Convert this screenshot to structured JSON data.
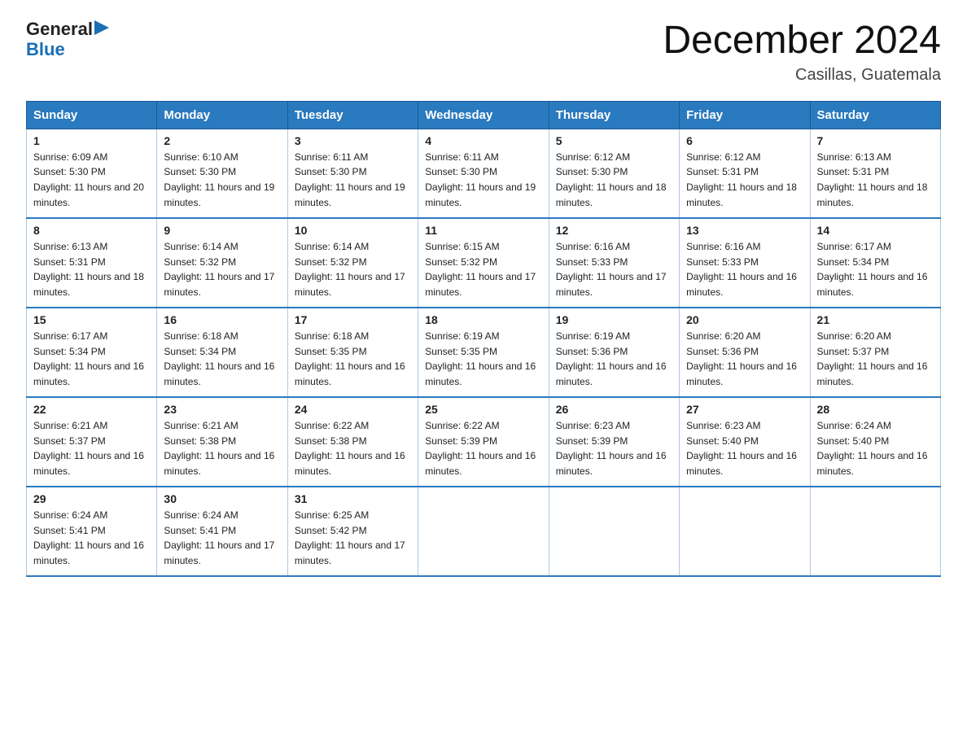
{
  "logo": {
    "general": "General",
    "triangle": "▶",
    "blue": "Blue"
  },
  "header": {
    "month": "December 2024",
    "location": "Casillas, Guatemala"
  },
  "weekdays": [
    "Sunday",
    "Monday",
    "Tuesday",
    "Wednesday",
    "Thursday",
    "Friday",
    "Saturday"
  ],
  "weeks": [
    [
      {
        "day": "1",
        "sunrise": "6:09 AM",
        "sunset": "5:30 PM",
        "daylight": "11 hours and 20 minutes."
      },
      {
        "day": "2",
        "sunrise": "6:10 AM",
        "sunset": "5:30 PM",
        "daylight": "11 hours and 19 minutes."
      },
      {
        "day": "3",
        "sunrise": "6:11 AM",
        "sunset": "5:30 PM",
        "daylight": "11 hours and 19 minutes."
      },
      {
        "day": "4",
        "sunrise": "6:11 AM",
        "sunset": "5:30 PM",
        "daylight": "11 hours and 19 minutes."
      },
      {
        "day": "5",
        "sunrise": "6:12 AM",
        "sunset": "5:30 PM",
        "daylight": "11 hours and 18 minutes."
      },
      {
        "day": "6",
        "sunrise": "6:12 AM",
        "sunset": "5:31 PM",
        "daylight": "11 hours and 18 minutes."
      },
      {
        "day": "7",
        "sunrise": "6:13 AM",
        "sunset": "5:31 PM",
        "daylight": "11 hours and 18 minutes."
      }
    ],
    [
      {
        "day": "8",
        "sunrise": "6:13 AM",
        "sunset": "5:31 PM",
        "daylight": "11 hours and 18 minutes."
      },
      {
        "day": "9",
        "sunrise": "6:14 AM",
        "sunset": "5:32 PM",
        "daylight": "11 hours and 17 minutes."
      },
      {
        "day": "10",
        "sunrise": "6:14 AM",
        "sunset": "5:32 PM",
        "daylight": "11 hours and 17 minutes."
      },
      {
        "day": "11",
        "sunrise": "6:15 AM",
        "sunset": "5:32 PM",
        "daylight": "11 hours and 17 minutes."
      },
      {
        "day": "12",
        "sunrise": "6:16 AM",
        "sunset": "5:33 PM",
        "daylight": "11 hours and 17 minutes."
      },
      {
        "day": "13",
        "sunrise": "6:16 AM",
        "sunset": "5:33 PM",
        "daylight": "11 hours and 16 minutes."
      },
      {
        "day": "14",
        "sunrise": "6:17 AM",
        "sunset": "5:34 PM",
        "daylight": "11 hours and 16 minutes."
      }
    ],
    [
      {
        "day": "15",
        "sunrise": "6:17 AM",
        "sunset": "5:34 PM",
        "daylight": "11 hours and 16 minutes."
      },
      {
        "day": "16",
        "sunrise": "6:18 AM",
        "sunset": "5:34 PM",
        "daylight": "11 hours and 16 minutes."
      },
      {
        "day": "17",
        "sunrise": "6:18 AM",
        "sunset": "5:35 PM",
        "daylight": "11 hours and 16 minutes."
      },
      {
        "day": "18",
        "sunrise": "6:19 AM",
        "sunset": "5:35 PM",
        "daylight": "11 hours and 16 minutes."
      },
      {
        "day": "19",
        "sunrise": "6:19 AM",
        "sunset": "5:36 PM",
        "daylight": "11 hours and 16 minutes."
      },
      {
        "day": "20",
        "sunrise": "6:20 AM",
        "sunset": "5:36 PM",
        "daylight": "11 hours and 16 minutes."
      },
      {
        "day": "21",
        "sunrise": "6:20 AM",
        "sunset": "5:37 PM",
        "daylight": "11 hours and 16 minutes."
      }
    ],
    [
      {
        "day": "22",
        "sunrise": "6:21 AM",
        "sunset": "5:37 PM",
        "daylight": "11 hours and 16 minutes."
      },
      {
        "day": "23",
        "sunrise": "6:21 AM",
        "sunset": "5:38 PM",
        "daylight": "11 hours and 16 minutes."
      },
      {
        "day": "24",
        "sunrise": "6:22 AM",
        "sunset": "5:38 PM",
        "daylight": "11 hours and 16 minutes."
      },
      {
        "day": "25",
        "sunrise": "6:22 AM",
        "sunset": "5:39 PM",
        "daylight": "11 hours and 16 minutes."
      },
      {
        "day": "26",
        "sunrise": "6:23 AM",
        "sunset": "5:39 PM",
        "daylight": "11 hours and 16 minutes."
      },
      {
        "day": "27",
        "sunrise": "6:23 AM",
        "sunset": "5:40 PM",
        "daylight": "11 hours and 16 minutes."
      },
      {
        "day": "28",
        "sunrise": "6:24 AM",
        "sunset": "5:40 PM",
        "daylight": "11 hours and 16 minutes."
      }
    ],
    [
      {
        "day": "29",
        "sunrise": "6:24 AM",
        "sunset": "5:41 PM",
        "daylight": "11 hours and 16 minutes."
      },
      {
        "day": "30",
        "sunrise": "6:24 AM",
        "sunset": "5:41 PM",
        "daylight": "11 hours and 17 minutes."
      },
      {
        "day": "31",
        "sunrise": "6:25 AM",
        "sunset": "5:42 PM",
        "daylight": "11 hours and 17 minutes."
      },
      null,
      null,
      null,
      null
    ]
  ],
  "labels": {
    "sunrise": "Sunrise:",
    "sunset": "Sunset:",
    "daylight": "Daylight:"
  }
}
